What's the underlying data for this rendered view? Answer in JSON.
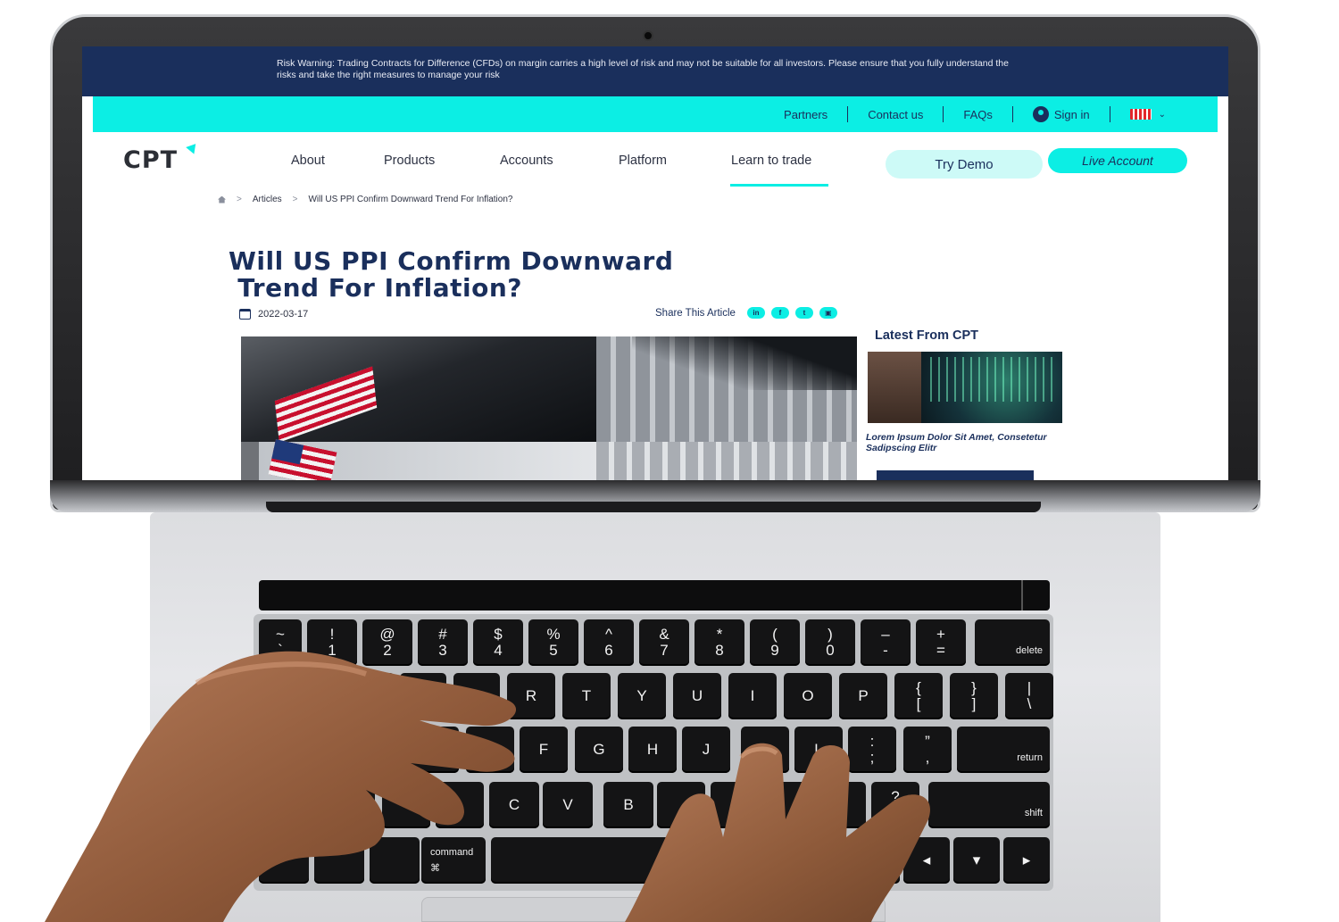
{
  "risk_warning": "Risk Warning: Trading Contracts for Difference (CFDs) on margin carries a high level of risk and may not be suitable for all investors. Please ensure that you fully understand the risks and take the right measures to manage your risk",
  "top_links": {
    "partners": "Partners",
    "contact": "Contact us",
    "faqs": "FAQs",
    "sign_in": "Sign in"
  },
  "logo": "CPT",
  "nav": {
    "about": "About",
    "products": "Products",
    "accounts": "Accounts",
    "platform": "Platform",
    "learn": "Learn to trade"
  },
  "buttons": {
    "demo": "Try Demo",
    "live": "Live Account"
  },
  "breadcrumb": {
    "section": "Articles",
    "current": "Will US PPI Confirm Downward Trend For Inflation?"
  },
  "article": {
    "title_line1": "Will US PPI Confirm Downward",
    "title_line2": "Trend For Inflation?",
    "date": "2022-03-17",
    "share_label": "Share This Article"
  },
  "social": [
    "in",
    "f",
    "t",
    "▣"
  ],
  "sidebar": {
    "title": "Latest From CPT",
    "caption": "Lorem Ipsum Dolor Sit Amet, Consetetur Sadipscing Elitr"
  },
  "keyboard": {
    "row1": [
      [
        "~",
        "`"
      ],
      [
        "!",
        "1"
      ],
      [
        "@",
        "2"
      ],
      [
        "#",
        "3"
      ],
      [
        "$",
        "4"
      ],
      [
        "%",
        "5"
      ],
      [
        "^",
        "6"
      ],
      [
        "&",
        "7"
      ],
      [
        "*",
        "8"
      ],
      [
        "(",
        "9"
      ],
      [
        ")",
        "0"
      ],
      [
        "–",
        "-"
      ],
      [
        "+",
        "="
      ]
    ],
    "delete": "delete",
    "row2": [
      "R",
      "T",
      "Y",
      "U",
      "I",
      "O",
      "P"
    ],
    "row2_brackets": [
      [
        "{",
        "["
      ],
      [
        "}",
        "]"
      ],
      [
        "|",
        "\\"
      ]
    ],
    "row3": [
      "F",
      "G",
      "H",
      "J",
      "L"
    ],
    "row3_punct": [
      [
        ":",
        ";"
      ],
      [
        "”",
        ","
      ]
    ],
    "return": "return",
    "row4": [
      "C",
      "V",
      "B"
    ],
    "row4_punct": [
      [
        "?",
        "/"
      ]
    ],
    "shift": "shift",
    "command": "command ⌘",
    "arrows": [
      "◂",
      "▾",
      "▴",
      "▸"
    ]
  },
  "colors": {
    "navy": "#1a2f5c",
    "cyan": "#0ceee4"
  }
}
